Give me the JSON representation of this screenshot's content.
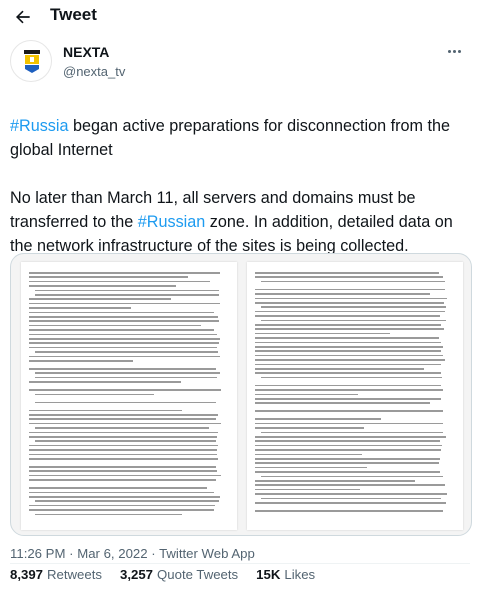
{
  "header": {
    "title": "Tweet"
  },
  "author": {
    "name": "NEXTA",
    "handle": "@nexta_tv"
  },
  "tweet": {
    "line1_tag": "#Russia",
    "line1_rest": " began active preparations for disconnection from the global Internet",
    "line2_pre": "No later than March 11, all servers and domains must be transferred to the ",
    "line2_tag": "#Russian",
    "line2_post": " zone. In addition, detailed data on the network infrastructure of the sites is being collected."
  },
  "meta": {
    "time": "11:26 PM",
    "sep": " · ",
    "date": "Mar 6, 2022",
    "source": "Twitter Web App"
  },
  "stats": {
    "retweets_count": "8,397",
    "retweets_label": "Retweets",
    "quotes_count": "3,257",
    "quotes_label": "Quote Tweets",
    "likes_count": "15K",
    "likes_label": "Likes"
  },
  "colors": {
    "link": "#1d9bf0",
    "secondary": "#536471",
    "text": "#0f1419",
    "border": "#cfd9de"
  },
  "icons": {
    "back": "arrow-left-icon",
    "more": "more-horizontal-icon",
    "avatar": "nexta-logo"
  }
}
